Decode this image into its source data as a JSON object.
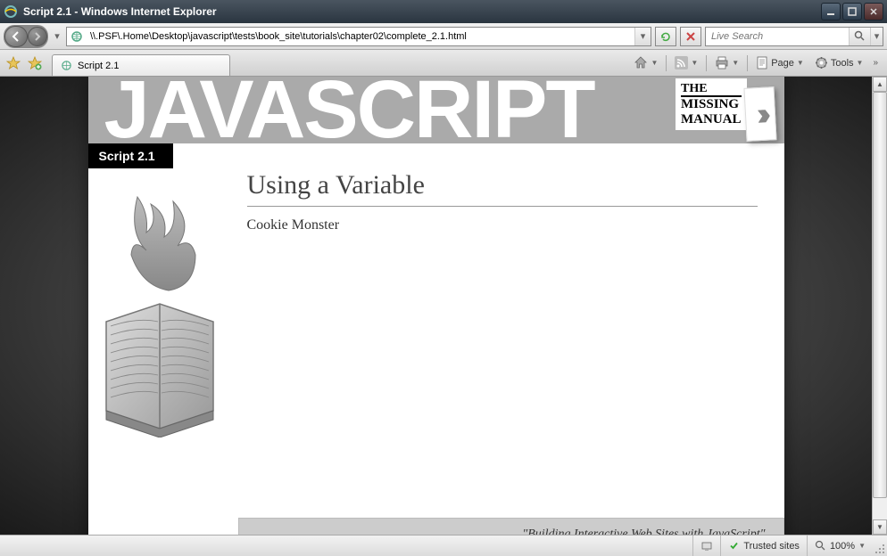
{
  "window": {
    "title": "Script 2.1 - Windows Internet Explorer"
  },
  "nav": {
    "url": "\\\\.PSF\\.Home\\Desktop\\javascript\\tests\\book_site\\tutorials\\chapter02\\complete_2.1.html",
    "search_placeholder": "Live Search"
  },
  "tab": {
    "title": "Script 2.1"
  },
  "toolbar": {
    "page_label": "Page",
    "tools_label": "Tools"
  },
  "page": {
    "logo_text": "JAVASCRIPT",
    "badge_line1": "THE",
    "badge_line2": "MISSING",
    "badge_line3": "MANUAL",
    "script_label": "Script 2.1",
    "heading": "Using a Variable",
    "output": "Cookie Monster",
    "footer": "\"Building Interactive Web Sites with JavaScript\""
  },
  "status": {
    "zone": "Trusted sites",
    "zoom": "100%"
  }
}
